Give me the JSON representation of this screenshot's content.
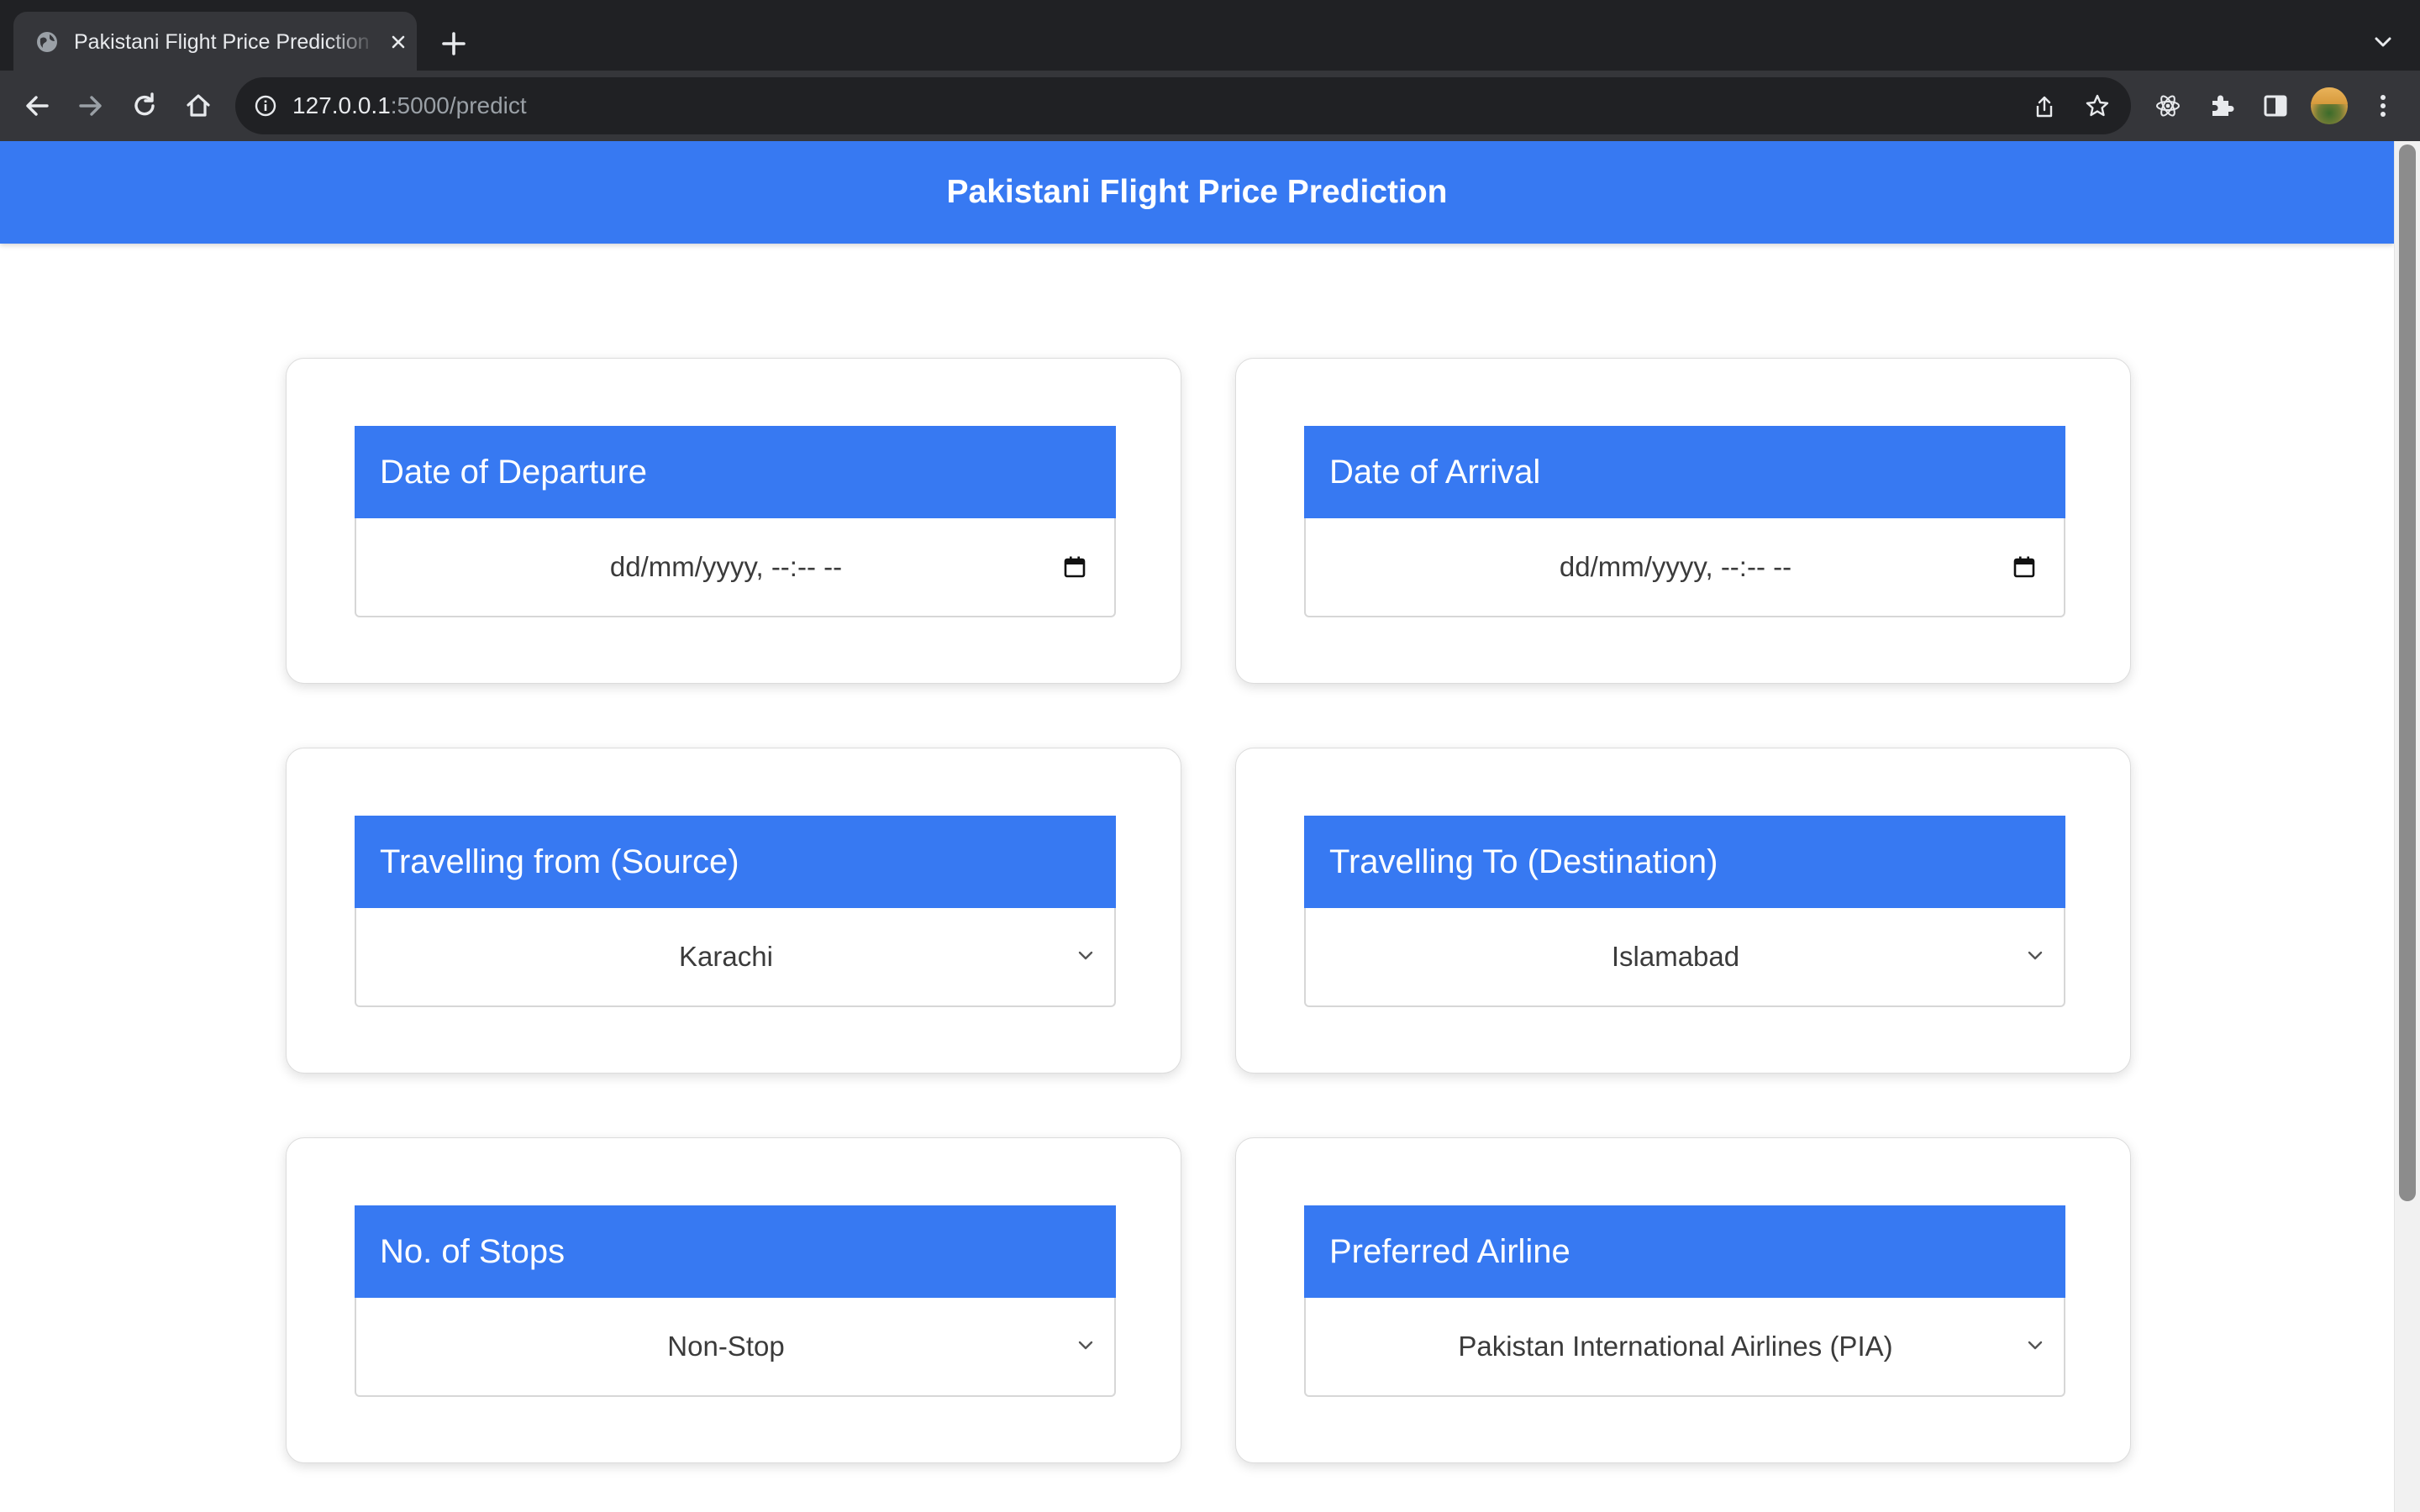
{
  "browser": {
    "tab_title": "Pakistani Flight Price Prediction",
    "url_host": "127.0.0.1",
    "url_rest": ":5000/predict"
  },
  "page": {
    "title": "Pakistani Flight Price Prediction",
    "accent_color": "#3779f2"
  },
  "fields": {
    "departure": {
      "label": "Date of Departure",
      "value": "dd/mm/yyyy, --:-- --",
      "control": "datetime"
    },
    "arrival": {
      "label": "Date of Arrival",
      "value": "dd/mm/yyyy, --:-- --",
      "control": "datetime"
    },
    "source": {
      "label": "Travelling from (Source)",
      "value": "Karachi",
      "control": "select"
    },
    "destination": {
      "label": "Travelling To (Destination)",
      "value": "Islamabad",
      "control": "select"
    },
    "stops": {
      "label": "No. of Stops",
      "value": "Non-Stop",
      "control": "select"
    },
    "airline": {
      "label": "Preferred Airline",
      "value": "Pakistan International Airlines (PIA)",
      "control": "select"
    }
  }
}
